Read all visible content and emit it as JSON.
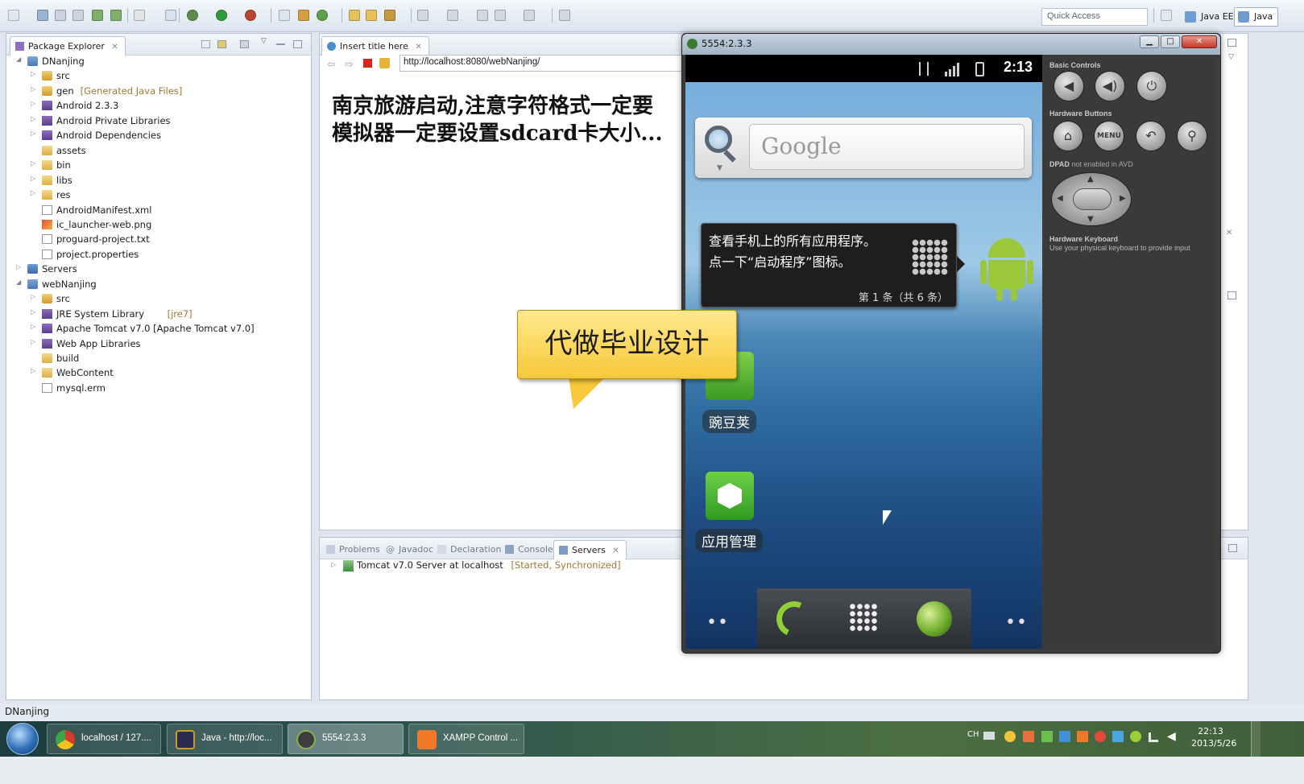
{
  "toolbar": {
    "quick_access_placeholder": "Quick Access",
    "perspectives": [
      "Java EE",
      "Java"
    ]
  },
  "package_explorer": {
    "tab_label": "Package Explorer",
    "tree": [
      {
        "label": "DNanjing",
        "level": 0,
        "icon": "project-icon",
        "expanded": true
      },
      {
        "label": "src",
        "level": 1,
        "icon": "package-folder-icon"
      },
      {
        "label": "gen",
        "decoration": "[Generated Java Files]",
        "level": 1,
        "icon": "package-folder-icon"
      },
      {
        "label": "Android 2.3.3",
        "level": 1,
        "icon": "library-icon"
      },
      {
        "label": "Android Private Libraries",
        "level": 1,
        "icon": "library-icon"
      },
      {
        "label": "Android Dependencies",
        "level": 1,
        "icon": "library-icon"
      },
      {
        "label": "assets",
        "level": 1,
        "icon": "folder-icon",
        "leaf": true
      },
      {
        "label": "bin",
        "level": 1,
        "icon": "folder-icon"
      },
      {
        "label": "libs",
        "level": 1,
        "icon": "folder-icon"
      },
      {
        "label": "res",
        "level": 1,
        "icon": "folder-icon"
      },
      {
        "label": "AndroidManifest.xml",
        "level": 1,
        "icon": "xml-file-icon",
        "leaf": true
      },
      {
        "label": "ic_launcher-web.png",
        "level": 1,
        "icon": "image-file-icon",
        "leaf": true
      },
      {
        "label": "proguard-project.txt",
        "level": 1,
        "icon": "text-file-icon",
        "leaf": true
      },
      {
        "label": "project.properties",
        "level": 1,
        "icon": "text-file-icon",
        "leaf": true
      },
      {
        "label": "Servers",
        "level": 0,
        "icon": "servers-folder-icon"
      },
      {
        "label": "webNanjing",
        "level": 0,
        "icon": "project-icon",
        "expanded": true
      },
      {
        "label": "src",
        "level": 1,
        "icon": "package-folder-icon"
      },
      {
        "label": "JRE System Library",
        "decoration": "[jre7]",
        "level": 1,
        "icon": "library-icon"
      },
      {
        "label": "Apache Tomcat v7.0 [Apache Tomcat v7.0]",
        "level": 1,
        "icon": "library-icon"
      },
      {
        "label": "Web App Libraries",
        "level": 1,
        "icon": "library-icon"
      },
      {
        "label": "build",
        "level": 1,
        "icon": "folder-icon",
        "leaf": true
      },
      {
        "label": "WebContent",
        "level": 1,
        "icon": "folder-icon"
      },
      {
        "label": "mysql.erm",
        "level": 1,
        "icon": "table-file-icon",
        "leaf": true
      }
    ]
  },
  "browser": {
    "tab_label": "Insert title here",
    "url": "http://localhost:8080/webNanjing/",
    "content_line1": "南京旅游启动,注意字符格式一定要",
    "content_line2": "模拟器一定要设置sdcard卡大小..."
  },
  "bottom_panel": {
    "tabs": [
      "Problems",
      "Javadoc",
      "Declaration",
      "Console",
      "Servers"
    ],
    "active_tab": "Servers",
    "server_name": "Tomcat v7.0 Server at localhost",
    "server_state": "[Started, Synchronized]"
  },
  "status_bar": {
    "text": "DNanjing"
  },
  "emulator": {
    "title": "5554:2.3.3",
    "clock": "2:13",
    "search_hint": "Google",
    "tip_line1": "查看手机上的所有应用程序。",
    "tip_line2": "点一下“启动程序”图标。",
    "tip_counter": "第 1 条（共 6 条）",
    "apps": [
      "豌豆荚",
      "应用管理"
    ],
    "controls": {
      "basic_controls": "Basic Controls",
      "hardware_buttons": "Hardware Buttons",
      "dpad_label": "DPAD",
      "dpad_note": "not enabled in AVD",
      "menu_label": "MENU",
      "keyboard_title": "Hardware Keyboard",
      "keyboard_note": "Use your physical keyboard to provide input"
    }
  },
  "overlay": {
    "bubble_text": "代做毕业设计"
  },
  "taskbar": {
    "buttons": [
      "localhost / 127....",
      "Java - http://loc...",
      "5554:2.3.3",
      "XAMPP Control ..."
    ],
    "lang": "CH",
    "time": "22:13",
    "date": "2013/5/26"
  },
  "colors": {
    "eclipse_frame": "#dfe6ef",
    "android_green": "#9bc83a",
    "bubble_yellow": "#f7c83a",
    "taskbar": "#2b5450"
  }
}
